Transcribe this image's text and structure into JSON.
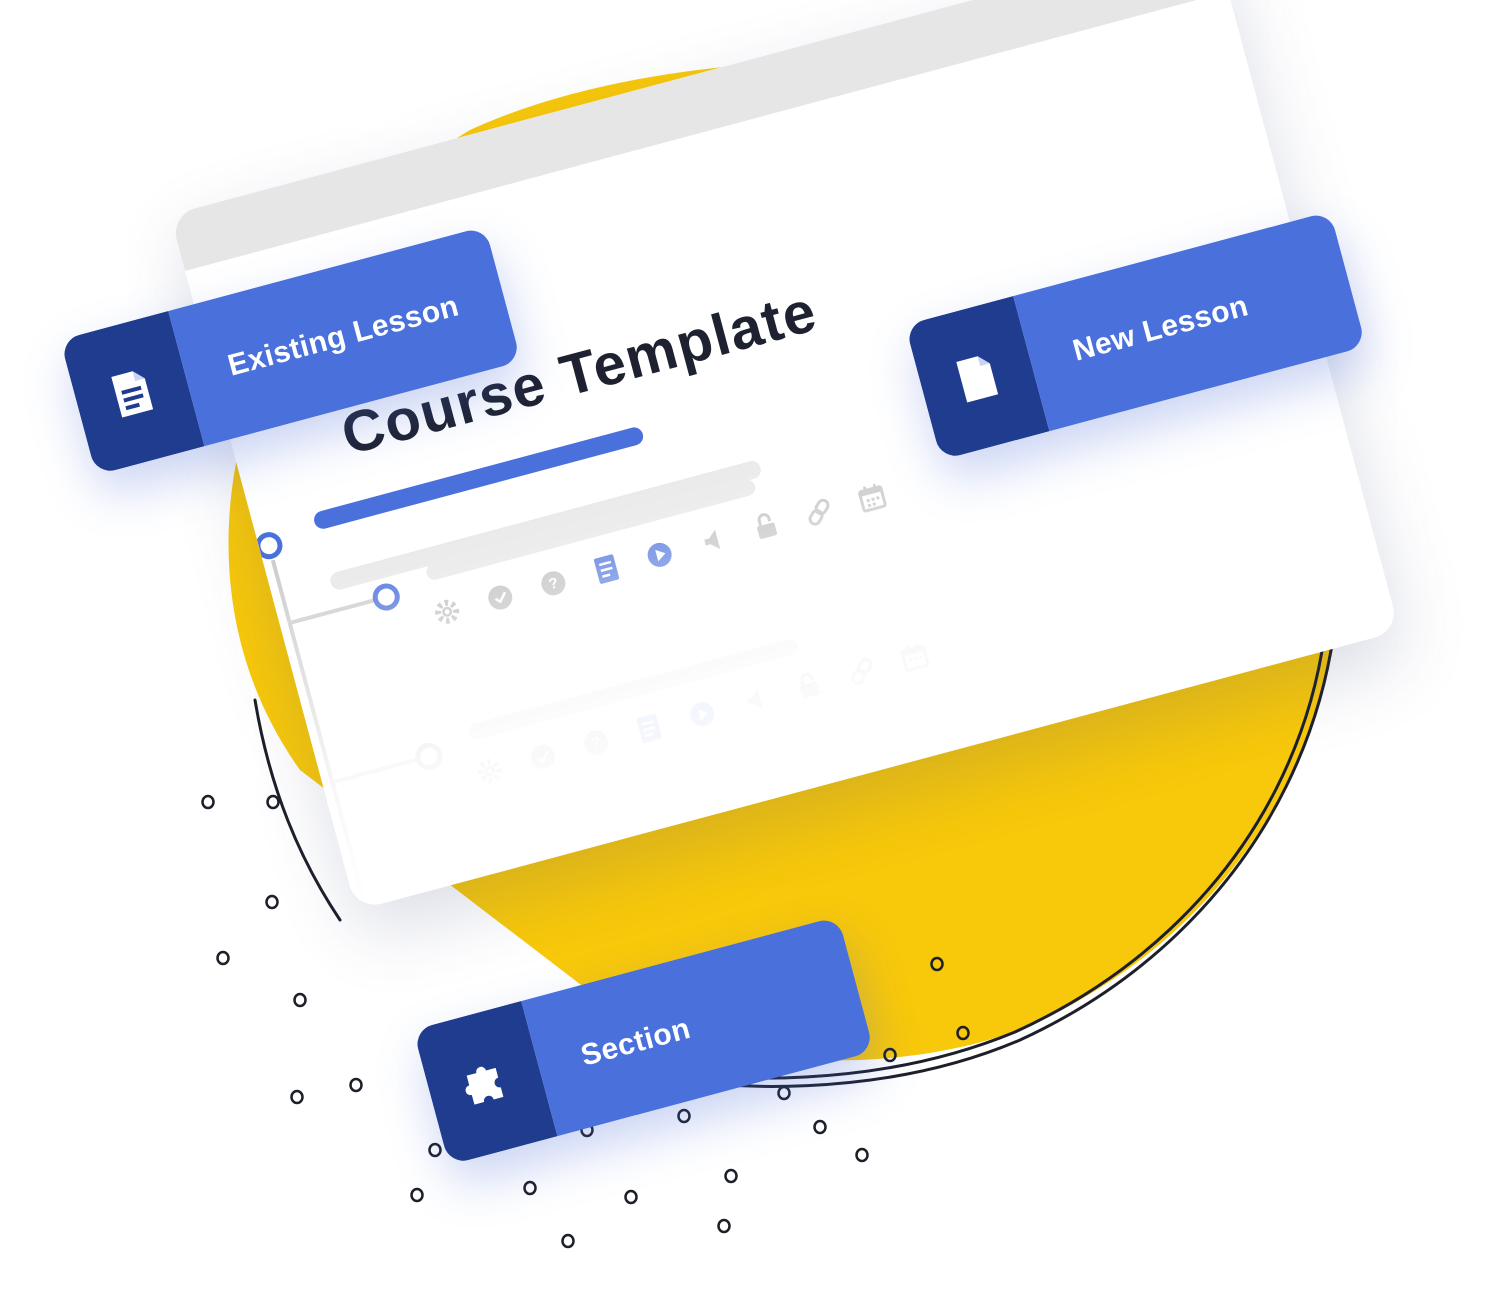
{
  "card": {
    "title": "Course Template"
  },
  "buttons": {
    "existing_lesson": {
      "label": "Existing Lesson",
      "icon": "document-lines-icon"
    },
    "new_lesson": {
      "label": "New Lesson",
      "icon": "document-icon"
    },
    "section": {
      "label": "Section",
      "icon": "puzzle-icon"
    }
  },
  "lesson_icons": [
    "gear-icon",
    "check-circle-icon",
    "question-circle-icon",
    "document-lines-icon",
    "play-circle-icon",
    "speaker-icon",
    "lock-icon",
    "link-icon",
    "calendar-icon"
  ],
  "colors": {
    "accent_blue": "#4a70dc",
    "dark_blue": "#1f3c8f",
    "yellow": "#f8c80a",
    "gray": "#bdbdbd"
  }
}
